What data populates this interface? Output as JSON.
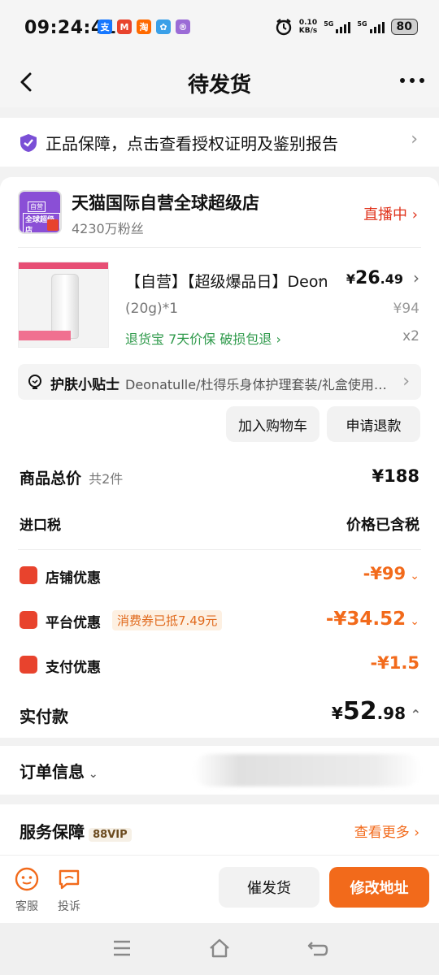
{
  "status_bar": {
    "time": "09:24:41",
    "apps": [
      {
        "icon": "alipay-icon",
        "glyph": "支",
        "color": "#1677ff"
      },
      {
        "icon": "taobao-m-icon",
        "glyph": "M",
        "color": "#e8432d"
      },
      {
        "icon": "taobao-icon",
        "glyph": "淘",
        "color": "#ff6a00"
      },
      {
        "icon": "flower-icon",
        "glyph": "✿",
        "color": "#3aa0e8"
      },
      {
        "icon": "r-app-icon",
        "glyph": "®",
        "color": "#9b6bd6"
      }
    ],
    "net_speed": "0.10",
    "net_unit": "KB/s",
    "signal1": "5G",
    "signal2": "5G",
    "battery": "80"
  },
  "header": {
    "title": "待发货"
  },
  "auth_banner": {
    "text": "正品保障，点击查看授权证明及鉴别报告"
  },
  "shop": {
    "logo_line1": "自营",
    "logo_line2": "全球超级店",
    "name": "天猫国际自营全球超级店",
    "fans": "4230万粉丝",
    "live": "直播中"
  },
  "product": {
    "title": "【自营】【超级爆品日】Deonatulle/杜得乐",
    "price_symbol": "¥",
    "price_int": "26",
    "price_dec": ".49",
    "spec": "(20g)*1",
    "original_price": "¥94",
    "services": "退货宝  7天价保  破损包退",
    "quantity": "x2"
  },
  "tip": {
    "label": "护肤小贴士",
    "text": "Deonatulle/杜得乐身体护理套装/礼盒使用指南"
  },
  "actions": {
    "add_cart": "加入购物车",
    "refund": "申请退款"
  },
  "summary": {
    "total_label": "商品总价",
    "total_count": "共2件",
    "total_amount": "¥188",
    "tax_label": "进口税",
    "tax_value": "价格已含税",
    "discounts": [
      {
        "label": "店铺优惠",
        "amount": "-¥99",
        "has_chevron": true,
        "icon": "shop-discount-icon"
      },
      {
        "label": "平台优惠",
        "amount": "-¥34.52",
        "has_chevron": true,
        "voucher": "消费券已抵7.49元",
        "icon": "platform-discount-icon"
      },
      {
        "label": "支付优惠",
        "amount": "-¥1.5",
        "has_chevron": false,
        "icon": "payment-discount-icon"
      }
    ],
    "paid_label": "实付款",
    "paid_symbol": "¥",
    "paid_int": "52",
    "paid_dec": ".98"
  },
  "order_info": {
    "label": "订单信息"
  },
  "service": {
    "label": "服务保障",
    "badge": "88VIP",
    "more": "查看更多"
  },
  "bottom": {
    "service_label": "客服",
    "complain_label": "投诉",
    "urge": "催发货",
    "modify_address": "修改地址"
  },
  "colors": {
    "accent": "#f26a1b",
    "live": "#e0331c",
    "green": "#2f9a4b"
  }
}
